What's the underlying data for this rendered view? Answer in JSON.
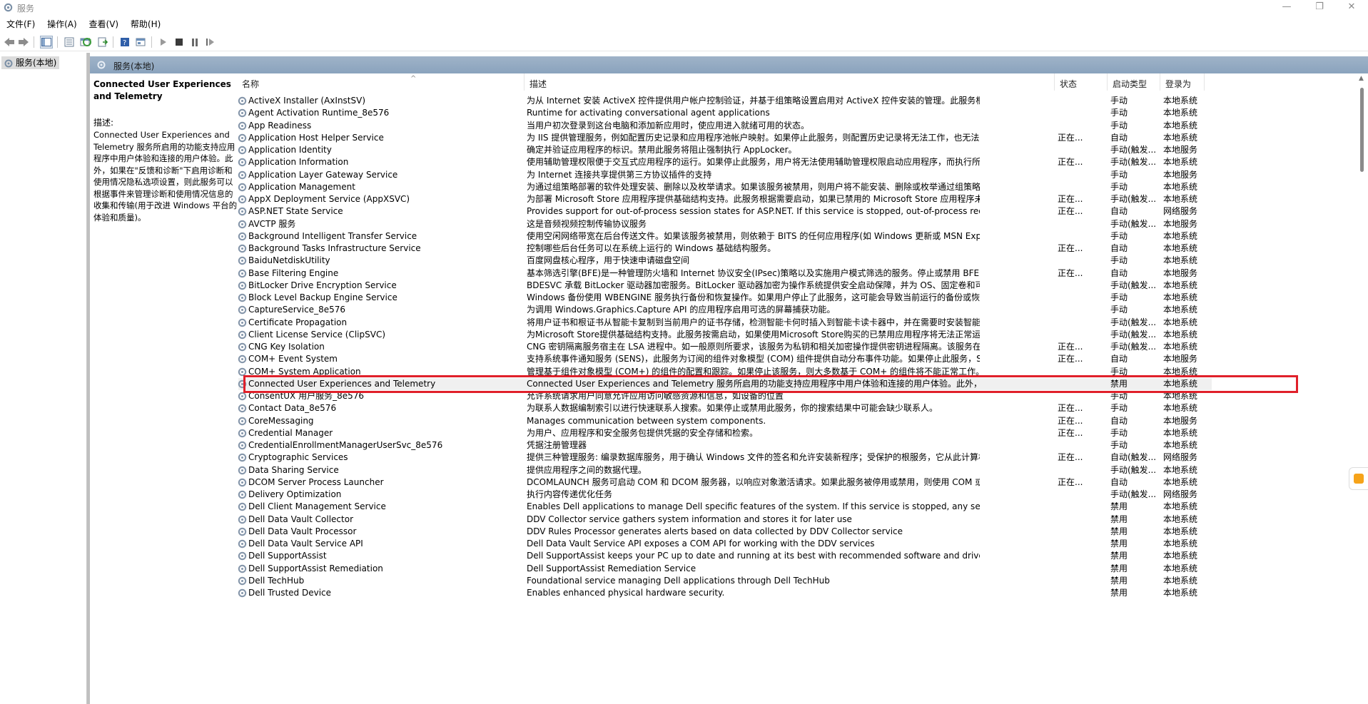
{
  "window": {
    "title": "服务",
    "minimize": "—",
    "maximize": "❐",
    "close": "✕"
  },
  "menu": [
    "文件(F)",
    "操作(A)",
    "查看(V)",
    "帮助(H)"
  ],
  "tree": {
    "root": "服务(本地)"
  },
  "pane_header": "服务(本地)",
  "selected_service": {
    "title": "Connected User Experiences and Telemetry",
    "desc_label": "描述:",
    "description": "Connected User Experiences and Telemetry 服务所启用的功能支持应用程序中用户体验和连接的用户体验。此外，如果在\"反馈和诊断\"下启用诊断和使用情况隐私选项设置，则此服务可以根据事件来管理诊断和使用情况信息的收集和传输(用于改进 Windows 平台的体验和质量)。"
  },
  "columns": {
    "name": "名称",
    "desc": "描述",
    "status": "状态",
    "startup": "启动类型",
    "logon": "登录为"
  },
  "rows": [
    {
      "name": "ActiveX Installer (AxInstSV)",
      "desc": "为从 Internet 安装 ActiveX 控件提供用户帐户控制验证，并基于组策略设置启用对 ActiveX 控件安装的管理。此服务根据要求启动，是否禁用...",
      "status": "",
      "startup": "手动",
      "logon": "本地系统"
    },
    {
      "name": "Agent Activation Runtime_8e576",
      "desc": "Runtime for activating conversational agent applications",
      "status": "",
      "startup": "手动",
      "logon": "本地系统"
    },
    {
      "name": "App Readiness",
      "desc": "当用户初次登录到这台电脑和添加新应用时，使应用进入就绪可用的状态。",
      "status": "",
      "startup": "手动",
      "logon": "本地系统"
    },
    {
      "name": "Application Host Helper Service",
      "desc": "为 IIS 提供管理服务，例如配置历史记录和应用程序池帐户映射。如果停止此服务，则配置历史记录将无法工作，也无法用特定于应用程序池的...",
      "status": "正在...",
      "startup": "自动",
      "logon": "本地系统"
    },
    {
      "name": "Application Identity",
      "desc": "确定并验证应用程序的标识。禁用此服务将阻止强制执行 AppLocker。",
      "status": "",
      "startup": "手动(触发...",
      "logon": "本地服务"
    },
    {
      "name": "Application Information",
      "desc": "使用辅助管理权限便于交互式应用程序的运行。如果停止此服务，用户将无法使用辅助管理权限启动应用程序，而执行所需用户任务可能需要这...",
      "status": "正在...",
      "startup": "手动(触发...",
      "logon": "本地系统"
    },
    {
      "name": "Application Layer Gateway Service",
      "desc": "为 Internet 连接共享提供第三方协议插件的支持",
      "status": "",
      "startup": "手动",
      "logon": "本地服务"
    },
    {
      "name": "Application Management",
      "desc": "为通过组策略部署的软件处理安装、删除以及枚举请求。如果该服务被禁用，则用户将不能安装、删除或枚举通过组策略部署的软件。如果此...",
      "status": "",
      "startup": "手动",
      "logon": "本地系统"
    },
    {
      "name": "AppX Deployment Service (AppXSVC)",
      "desc": "为部署 Microsoft Store 应用程序提供基础结构支持。此服务根据需要启动，如果已禁用的 Microsoft Store 应用程序未部署到系统，此服务...",
      "status": "正在...",
      "startup": "手动(触发...",
      "logon": "本地系统"
    },
    {
      "name": "ASP.NET State Service",
      "desc": "Provides support for out-of-process session states for ASP.NET. If this service is stopped, out-of-process requests will not be pr...",
      "status": "正在...",
      "startup": "自动",
      "logon": "网络服务"
    },
    {
      "name": "AVCTP 服务",
      "desc": "这是音频视频控制传输协议服务",
      "status": "",
      "startup": "手动(触发...",
      "logon": "本地服务"
    },
    {
      "name": "Background Intelligent Transfer Service",
      "desc": "使用空闲网络带宽在后台传送文件。如果该服务被禁用，则依赖于 BITS 的任何应用程序(如 Windows 更新或 MSN Explorer)将无法自动下载...",
      "status": "",
      "startup": "手动",
      "logon": "本地系统"
    },
    {
      "name": "Background Tasks Infrastructure Service",
      "desc": "控制哪些后台任务可以在系统上运行的 Windows 基础结构服务。",
      "status": "正在...",
      "startup": "自动",
      "logon": "本地系统"
    },
    {
      "name": "BaiduNetdiskUtility",
      "desc": "百度网盘核心程序，用于快速申请磁盘空间",
      "status": "",
      "startup": "手动",
      "logon": "本地系统"
    },
    {
      "name": "Base Filtering Engine",
      "desc": "基本筛选引擎(BFE)是一种管理防火墙和 Internet 协议安全(IPsec)策略以及实施用户模式筛选的服务。停止或禁用 BFE 服务将大大降低系统的...",
      "status": "正在...",
      "startup": "自动",
      "logon": "本地服务"
    },
    {
      "name": "BitLocker Drive Encryption Service",
      "desc": "BDESVC 承载 BitLocker 驱动器加密服务。BitLocker 驱动器加密为操作系统提供安全启动保障，并为 OS、固定卷和可移动卷提供全卷加密功...",
      "status": "",
      "startup": "手动(触发...",
      "logon": "本地系统"
    },
    {
      "name": "Block Level Backup Engine Service",
      "desc": "Windows 备份使用 WBENGINE 服务执行备份和恢复操作。如果用户停止了此服务，这可能会导致当前运行的备份或恢复操作失败。使用此计...",
      "status": "",
      "startup": "手动",
      "logon": "本地系统"
    },
    {
      "name": "CaptureService_8e576",
      "desc": "为调用 Windows.Graphics.Capture API 的应用程序启用可选的屏幕捕获功能。",
      "status": "",
      "startup": "手动",
      "logon": "本地系统"
    },
    {
      "name": "Certificate Propagation",
      "desc": "将用户证书和根证书从智能卡复制到当前用户的证书存储，检测智能卡何时插入到智能卡读卡器中，并在需要时安装智能卡即插即用微型驱动器...",
      "status": "",
      "startup": "手动(触发...",
      "logon": "本地系统"
    },
    {
      "name": "Client License Service (ClipSVC)",
      "desc": "为Microsoft Store提供基础结构支持。此服务按需启动，如果使用Microsoft Store购买的已禁用应用程序将无法正常运行。",
      "status": "",
      "startup": "手动(触发...",
      "logon": "本地系统"
    },
    {
      "name": "CNG Key Isolation",
      "desc": "CNG 密钥隔离服务宿主在 LSA 进程中。如一般原则所要求，该服务为私钥和相关加密操作提供密钥进程隔离。该服务在与一般原则要求相一致...",
      "status": "正在...",
      "startup": "手动(触发...",
      "logon": "本地系统"
    },
    {
      "name": "COM+ Event System",
      "desc": "支持系统事件通知服务 (SENS)，此服务为订阅的组件对象模型 (COM) 组件提供自动分布事件功能。如果停止此服务，SENS 将关闭，而且不...",
      "status": "正在...",
      "startup": "自动",
      "logon": "本地服务"
    },
    {
      "name": "COM+ System Application",
      "desc": "管理基于组件对象模型 (COM+) 的组件的配置和跟踪。如果停止该服务，则大多数基于 COM+ 的组件将不能正常工作。如果禁用该服务，则...",
      "status": "",
      "startup": "手动",
      "logon": "本地系统"
    },
    {
      "name": "Connected User Experiences and Telemetry",
      "desc": "Connected User Experiences and Telemetry 服务所启用的功能支持应用程序中用户体验和连接的用户体验。此外，如果在\"反馈和诊断\"下...",
      "status": "",
      "startup": "禁用",
      "logon": "本地系统"
    },
    {
      "name": "ConsentUX 用户服务_8e576",
      "desc": "允许系统请求用户同意允许应用访问敏感资源和信息，如设备的位置",
      "status": "",
      "startup": "手动",
      "logon": "本地系统"
    },
    {
      "name": "Contact Data_8e576",
      "desc": "为联系人数据编制索引以进行快速联系人搜索。如果停止或禁用此服务，你的搜索结果中可能会缺少联系人。",
      "status": "正在...",
      "startup": "手动",
      "logon": "本地系统"
    },
    {
      "name": "CoreMessaging",
      "desc": "Manages communication between system components.",
      "status": "正在...",
      "startup": "自动",
      "logon": "本地服务"
    },
    {
      "name": "Credential Manager",
      "desc": "为用户、应用程序和安全服务包提供凭据的安全存储和检索。",
      "status": "正在...",
      "startup": "手动",
      "logon": "本地系统"
    },
    {
      "name": "CredentialEnrollmentManagerUserSvc_8e576",
      "desc": "凭据注册管理器",
      "status": "",
      "startup": "手动",
      "logon": "本地系统"
    },
    {
      "name": "Cryptographic Services",
      "desc": "提供三种管理服务: 编录数据库服务，用于确认 Windows 文件的签名和允许安装新程序；受保护的根服务，它从此计算机添加和删除受信任的...",
      "status": "正在...",
      "startup": "自动(触发...",
      "logon": "网络服务"
    },
    {
      "name": "Data Sharing Service",
      "desc": "提供应用程序之间的数据代理。",
      "status": "",
      "startup": "手动(触发...",
      "logon": "本地系统"
    },
    {
      "name": "DCOM Server Process Launcher",
      "desc": "DCOMLAUNCH 服务可启动 COM 和 DCOM 服务器，以响应对象激活请求。如果此服务被停用或禁用，则使用 COM 或 DCOM 的程序将无...",
      "status": "正在...",
      "startup": "自动",
      "logon": "本地系统"
    },
    {
      "name": "Delivery Optimization",
      "desc": "执行内容传递优化任务",
      "status": "",
      "startup": "手动(触发...",
      "logon": "网络服务"
    },
    {
      "name": "Dell Client Management Service",
      "desc": "Enables Dell applications to manage Dell specific features of the system. If this service is stopped, any services that explicitly dep...",
      "status": "",
      "startup": "禁用",
      "logon": "本地系统"
    },
    {
      "name": "Dell Data Vault Collector",
      "desc": "DDV Collector service gathers system information and stores it for later use",
      "status": "",
      "startup": "禁用",
      "logon": "本地系统"
    },
    {
      "name": "Dell Data Vault Processor",
      "desc": "DDV Rules Processor generates alerts based on data collected by DDV Collector service",
      "status": "",
      "startup": "禁用",
      "logon": "本地系统"
    },
    {
      "name": "Dell Data Vault Service API",
      "desc": "Dell Data Vault Service API exposes a COM API for working with the DDV services",
      "status": "",
      "startup": "禁用",
      "logon": "本地系统"
    },
    {
      "name": "Dell SupportAssist",
      "desc": "Dell SupportAssist keeps your PC up to date and running at its best with recommended software and driver updates. It also help...",
      "status": "",
      "startup": "禁用",
      "logon": "本地系统"
    },
    {
      "name": "Dell SupportAssist Remediation",
      "desc": "Dell SupportAssist Remediation Service",
      "status": "",
      "startup": "禁用",
      "logon": "本地系统"
    },
    {
      "name": "Dell TechHub",
      "desc": "Foundational service managing Dell applications through Dell TechHub",
      "status": "",
      "startup": "禁用",
      "logon": "本地系统"
    },
    {
      "name": "Dell Trusted Device",
      "desc": "Enables enhanced physical hardware security.",
      "status": "",
      "startup": "禁用",
      "logon": "本地系统"
    }
  ],
  "colors": {
    "pane_header": "#9fb3c8",
    "highlight": "#e0202a",
    "selected_row": "#f0f0f0"
  }
}
